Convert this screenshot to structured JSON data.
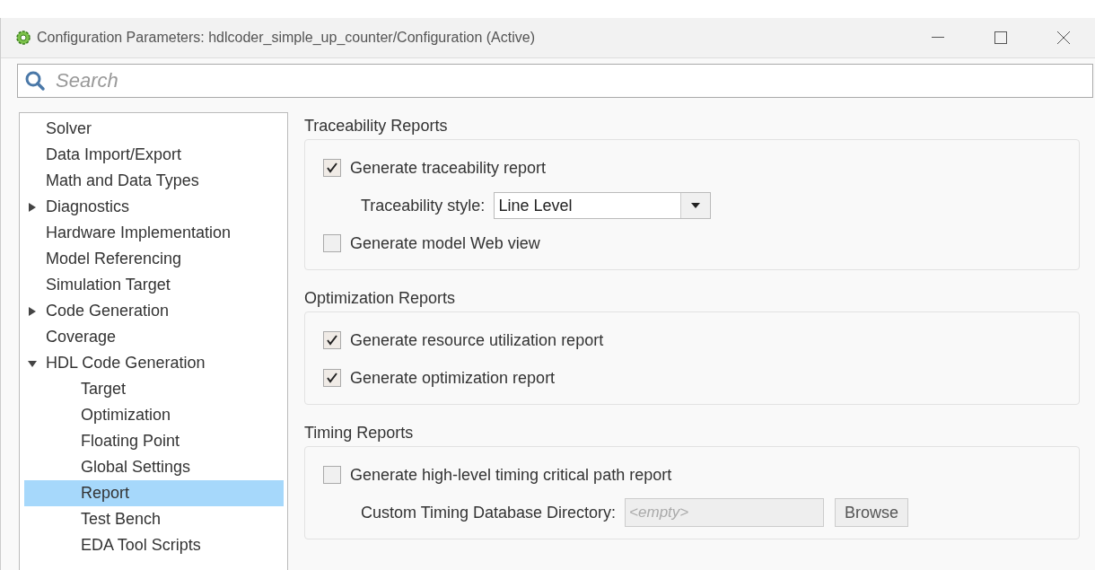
{
  "window": {
    "title": "Configuration Parameters: hdlcoder_simple_up_counter/Configuration (Active)"
  },
  "search": {
    "placeholder": "Search"
  },
  "sidebar": {
    "items": [
      {
        "label": "Solver",
        "selected": false
      },
      {
        "label": "Data Import/Export",
        "selected": false
      },
      {
        "label": "Math and Data Types",
        "selected": false
      },
      {
        "label": "Diagnostics",
        "selected": false,
        "expanded": false
      },
      {
        "label": "Hardware Implementation",
        "selected": false
      },
      {
        "label": "Model Referencing",
        "selected": false
      },
      {
        "label": "Simulation Target",
        "selected": false
      },
      {
        "label": "Code Generation",
        "selected": false,
        "expanded": false
      },
      {
        "label": "Coverage",
        "selected": false
      },
      {
        "label": "HDL Code Generation",
        "selected": false,
        "expanded": true,
        "children": [
          {
            "label": "Target",
            "selected": false
          },
          {
            "label": "Optimization",
            "selected": false
          },
          {
            "label": "Floating Point",
            "selected": false
          },
          {
            "label": "Global Settings",
            "selected": false
          },
          {
            "label": "Report",
            "selected": true
          },
          {
            "label": "Test Bench",
            "selected": false
          },
          {
            "label": "EDA Tool Scripts",
            "selected": false
          }
        ]
      }
    ]
  },
  "sections": [
    {
      "title": "Traceability Reports",
      "items": [
        {
          "kind": "checkbox",
          "label": "Generate traceability report",
          "checked": true
        },
        {
          "kind": "dropdown",
          "label": "Traceability style:",
          "value": "Line Level"
        },
        {
          "kind": "checkbox",
          "label": "Generate model Web view",
          "checked": false
        }
      ]
    },
    {
      "title": "Optimization Reports",
      "items": [
        {
          "kind": "checkbox",
          "label": "Generate resource utilization report",
          "checked": true
        },
        {
          "kind": "checkbox",
          "label": "Generate optimization report",
          "checked": true
        }
      ]
    },
    {
      "title": "Timing Reports",
      "items": [
        {
          "kind": "checkbox",
          "label": "Generate high-level timing critical path report",
          "checked": false
        },
        {
          "kind": "path",
          "label": "Custom Timing Database Directory:",
          "placeholder": "<empty>",
          "disabled": true,
          "button": "Browse"
        }
      ]
    }
  ]
}
